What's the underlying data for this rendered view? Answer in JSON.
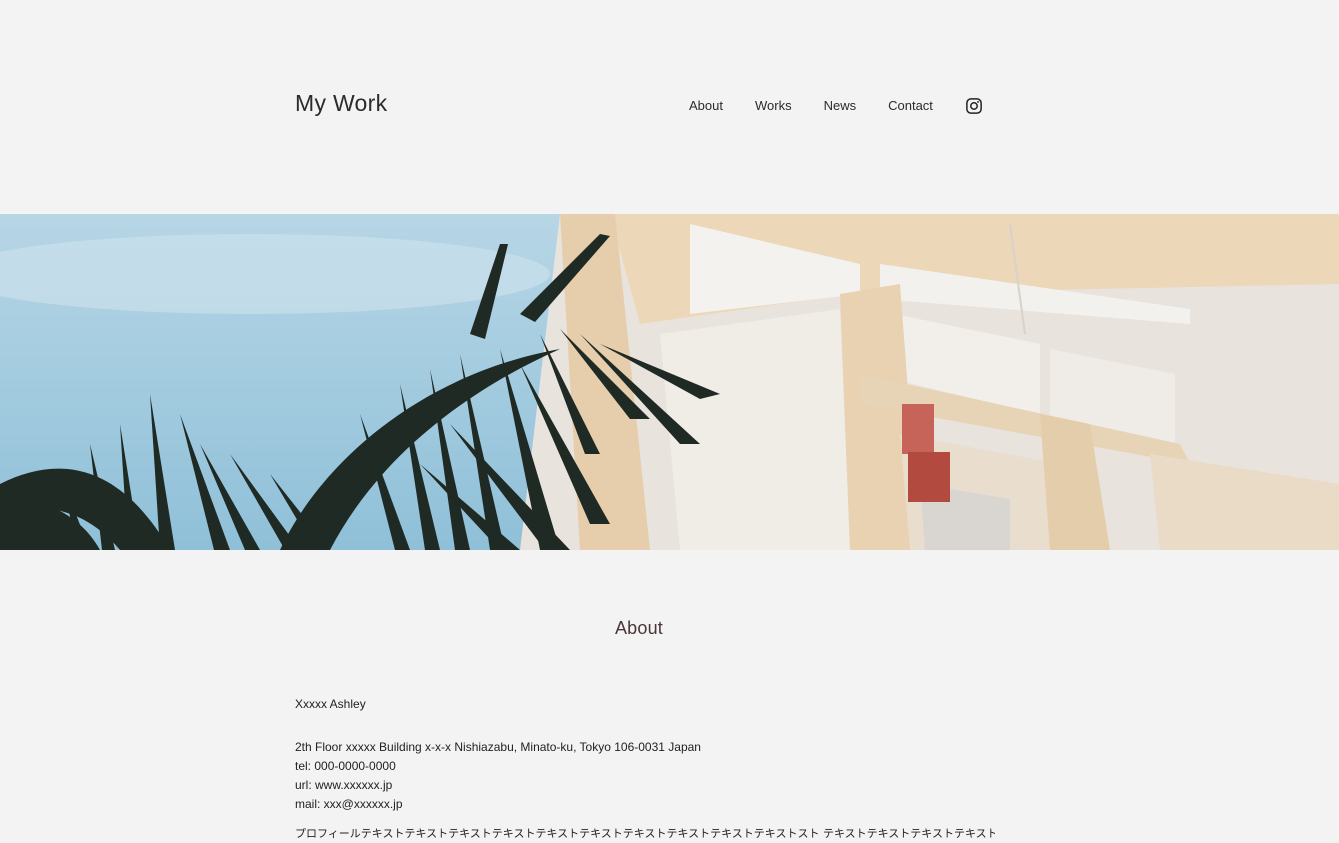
{
  "header": {
    "logo": "My Work",
    "nav": [
      {
        "label": "About"
      },
      {
        "label": "Works"
      },
      {
        "label": "News"
      },
      {
        "label": "Contact"
      }
    ],
    "social_icon": "instagram-icon"
  },
  "hero": {
    "image": "building-and-palm-photo"
  },
  "about": {
    "title": "About",
    "name": "Xxxxx Ashley",
    "address": "2th Floor xxxxx Building x-x-x Nishiazabu, Minato-ku, Tokyo 106-0031 Japan",
    "tel": "tel: 000-0000-0000",
    "url": "url: www.xxxxxx.jp",
    "mail": "mail: xxx@xxxxxx.jp",
    "profile": "プロフィールテキストテキストテキストテキストテキストテキストテキストテキストテキストテキストスト テキストテキストテキストテキストテキ"
  },
  "colors": {
    "background": "#f3f3f3",
    "text": "#222222",
    "section_title": "#4a3636",
    "sky": "#a9cde0",
    "building": "#e9d8bf"
  }
}
